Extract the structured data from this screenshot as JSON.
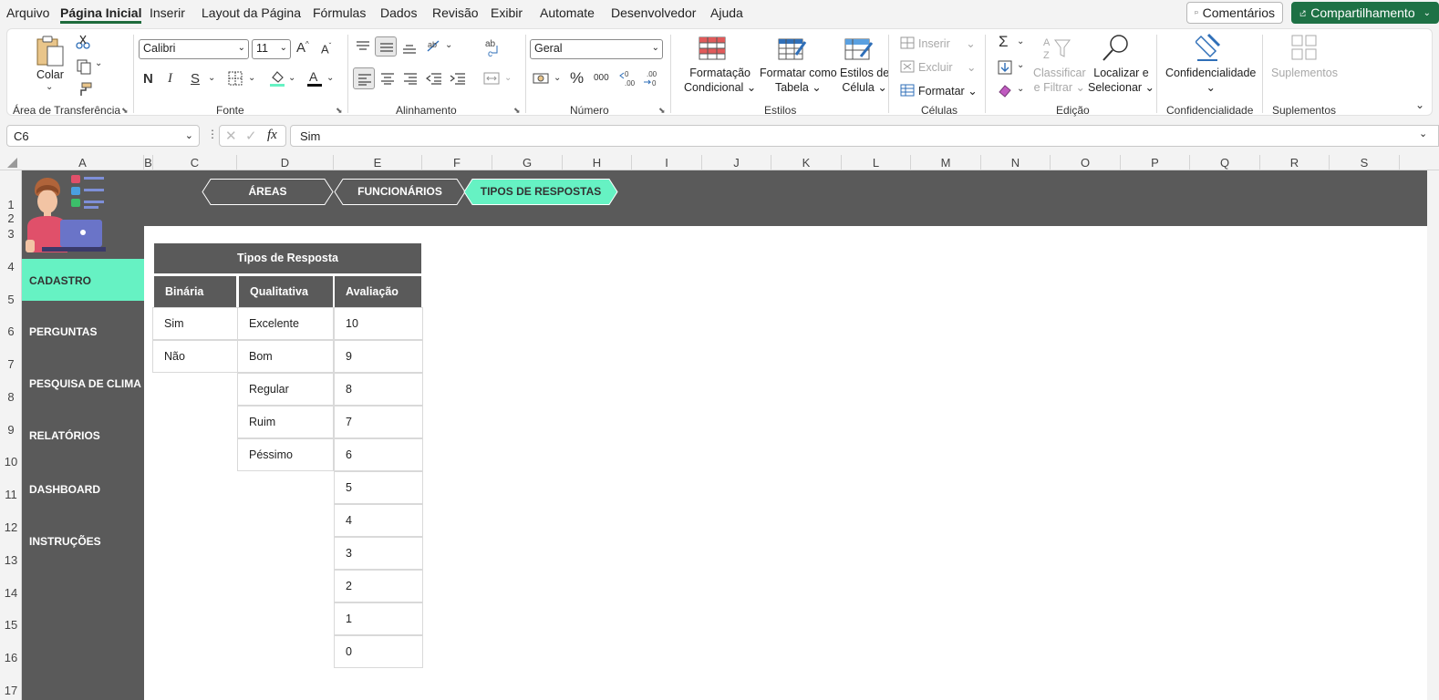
{
  "menu": {
    "items": [
      "Arquivo",
      "Página Inicial",
      "Inserir",
      "Layout da Página",
      "Fórmulas",
      "Dados",
      "Revisão",
      "Exibir",
      "Automate",
      "Desenvolvedor",
      "Ajuda"
    ],
    "active_index": 1,
    "comments_label": "Comentários",
    "share_label": "Compartilhamento"
  },
  "ribbon": {
    "clipboard": {
      "paste_label": "Colar",
      "group_label": "Área de Transferência"
    },
    "font": {
      "font_name": "Calibri",
      "font_size": "11",
      "group_label": "Fonte",
      "bold": "N",
      "italic": "I",
      "underline": "S"
    },
    "alignment": {
      "group_label": "Alinhamento"
    },
    "number": {
      "format": "Geral",
      "group_label": "Número",
      "percent": "%",
      "thousands": "000"
    },
    "styles": {
      "cond_format": "Formatação",
      "cond_format2": "Condicional",
      "format_table": "Formatar como",
      "format_table2": "Tabela",
      "cell_styles": "Estilos de",
      "cell_styles2": "Célula",
      "group_label": "Estilos"
    },
    "cells": {
      "insert": "Inserir",
      "delete": "Excluir",
      "format": "Formatar",
      "group_label": "Células"
    },
    "editing": {
      "sort": "Classificar",
      "sort2": "e Filtrar",
      "find": "Localizar e",
      "find2": "Selecionar",
      "group_label": "Edição"
    },
    "sensitivity": {
      "label": "Confidencialidade",
      "group_label": "Confidencialidade"
    },
    "addins": {
      "label": "Suplementos",
      "group_label": "Suplementos"
    }
  },
  "formula_bar": {
    "name_box": "C6",
    "fx": "fx",
    "formula": "Sim"
  },
  "columns": [
    "A",
    "B",
    "C",
    "D",
    "E",
    "F",
    "G",
    "H",
    "I",
    "J",
    "K",
    "L",
    "M",
    "N",
    "O",
    "P",
    "Q",
    "R",
    "S"
  ],
  "rows": [
    "1",
    "2",
    "3",
    "4",
    "5",
    "6",
    "7",
    "8",
    "9",
    "10",
    "11",
    "12",
    "13",
    "14",
    "15",
    "16",
    "17"
  ],
  "nav_tabs": [
    {
      "label": "ÁREAS",
      "active": false
    },
    {
      "label": "FUNCIONÁRIOS",
      "active": false
    },
    {
      "label": "TIPOS DE RESPOSTAS",
      "active": true
    }
  ],
  "sidebar": [
    "CADASTRO",
    "PERGUNTAS",
    "PESQUISA DE CLIMA",
    "RELATÓRIOS",
    "DASHBOARD",
    "INSTRUÇÕES"
  ],
  "sidebar_active": 0,
  "colors": {
    "accent": "#66f2c3",
    "panel": "#5a5a5a",
    "share_green": "#1e7145"
  },
  "table": {
    "title": "Tipos de Resposta",
    "headers": [
      "Binária",
      "Qualitativa",
      "Avaliação"
    ],
    "binaria": [
      "Sim",
      "Não"
    ],
    "qualitativa": [
      "Excelente",
      "Bom",
      "Regular",
      "Ruim",
      "Péssimo"
    ],
    "avaliacao": [
      "10",
      "9",
      "8",
      "7",
      "6",
      "5",
      "4",
      "3",
      "2",
      "1",
      "0"
    ]
  }
}
